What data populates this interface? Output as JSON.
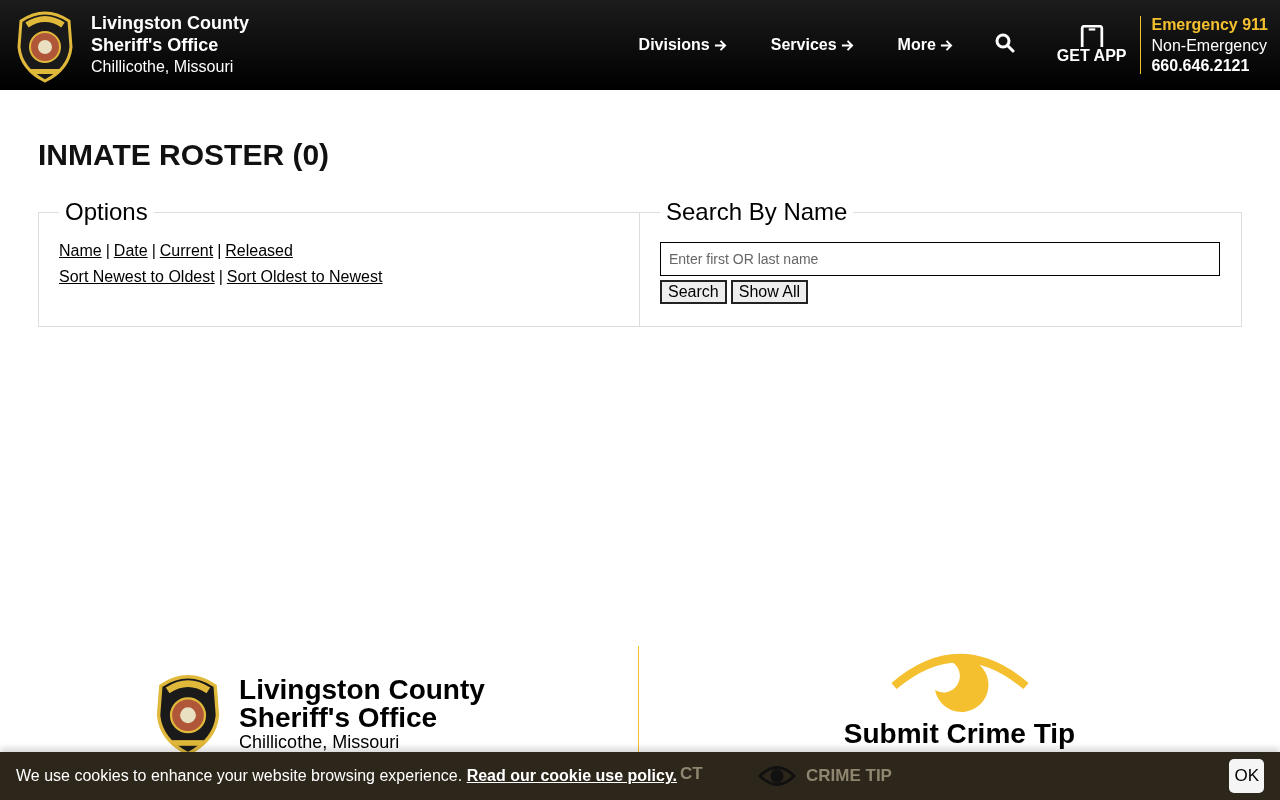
{
  "header": {
    "title_line1": "Livingston County",
    "title_line2": "Sheriff's Office",
    "location": "Chillicothe, Missouri",
    "nav": [
      {
        "label": "Divisions"
      },
      {
        "label": "Services"
      },
      {
        "label": "More"
      }
    ],
    "get_app": "GET APP",
    "emergency": "Emergency 911",
    "non_emergency_label": "Non-Emergency",
    "non_emergency_phone": "660.646.2121"
  },
  "page_title": "INMATE ROSTER (0)",
  "options": {
    "legend": "Options",
    "filter_links": [
      "Name",
      "Date",
      "Current",
      "Released"
    ],
    "sort_links": [
      "Sort Newest to Oldest",
      "Sort Oldest to Newest"
    ],
    "separator": "|"
  },
  "search": {
    "legend": "Search By Name",
    "placeholder": "Enter first OR last name",
    "buttons": [
      "Search",
      "Show All"
    ]
  },
  "footer": {
    "title_line1": "Livingston County",
    "title_line2": "Sheriff's Office",
    "location": "Chillicothe, Missouri",
    "crime_tip": "Submit Crime Tip"
  },
  "bottom_nav": [
    {
      "label": "CT"
    },
    {
      "label": "CRIME TIP"
    }
  ],
  "cookie_bar": {
    "text": "We use cookies to enhance your website browsing experience.",
    "link": "Read our cookie use policy.",
    "ok": "OK"
  }
}
